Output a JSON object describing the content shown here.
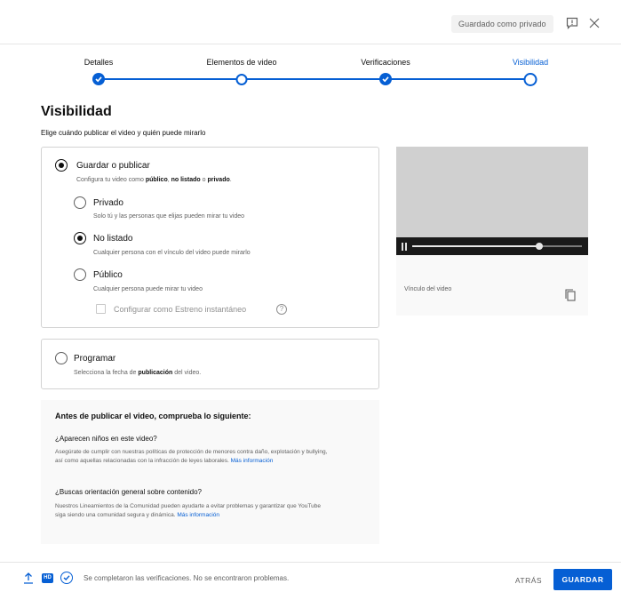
{
  "header": {
    "saved_status": "Guardado como privado",
    "feedback_icon": "feedback-icon",
    "close_icon": "close-icon"
  },
  "stepper": {
    "steps": [
      {
        "label": "Detalles",
        "state": "done"
      },
      {
        "label": "Elementos de video",
        "state": "pending"
      },
      {
        "label": "Verificaciones",
        "state": "done"
      },
      {
        "label": "Visibilidad",
        "state": "current"
      }
    ],
    "accent": "#065fd4"
  },
  "visibility": {
    "title": "Visibilidad",
    "subtitle": "Elige cuándo publicar el video y quién puede mirarlo",
    "save_publish": {
      "label": "Guardar o publicar",
      "desc_prefix": "Configura tu video como ",
      "desc_public": "público",
      "desc_sep1": ", ",
      "desc_unlisted": "no listado",
      "desc_sep2": " o ",
      "desc_private": "privado",
      "desc_suffix": ".",
      "selected": true,
      "options": [
        {
          "label": "Privado",
          "desc": "Solo tú y las personas que elijas pueden mirar tu video",
          "selected": false
        },
        {
          "label": "No listado",
          "desc": "Cualquier persona con el vínculo del video puede mirarlo",
          "selected": true
        },
        {
          "label": "Público",
          "desc": "Cualquier persona puede mirar tu video",
          "selected": false
        }
      ],
      "premiere_label": "Configurar como Estreno instantáneo",
      "premiere_checked": false,
      "help_glyph": "?"
    },
    "schedule": {
      "label": "Programar",
      "desc_prefix": "Selecciona la fecha de ",
      "desc_bold": "publicación",
      "desc_suffix": " del video.",
      "selected": false
    }
  },
  "preview": {
    "link_label": "Vínculo del video",
    "progress": 0.75,
    "copy_icon": "copy-icon"
  },
  "checklist": {
    "title": "Antes de publicar el video, comprueba lo siguiente:",
    "q1": "¿Aparecen niños en este video?",
    "q1_text": "Asegúrate de cumplir con nuestras políticas de protección de menores contra daño, explotación y bullying, así como aquellas relacionadas con la infracción de leyes laborales. ",
    "q1_link": "Más información",
    "q2": "¿Buscas orientación general sobre contenido?",
    "q2_text": "Nuestros Lineamientos de la Comunidad pueden ayudarte a evitar problemas y garantizar que YouTube siga siendo una comunidad segura y dinámica. ",
    "q2_link": "Más información"
  },
  "footer": {
    "hd_label": "HD",
    "status": "Se completaron las verificaciones. No se encontraron problemas.",
    "back_label": "ATRÁS",
    "save_label": "GUARDAR"
  }
}
